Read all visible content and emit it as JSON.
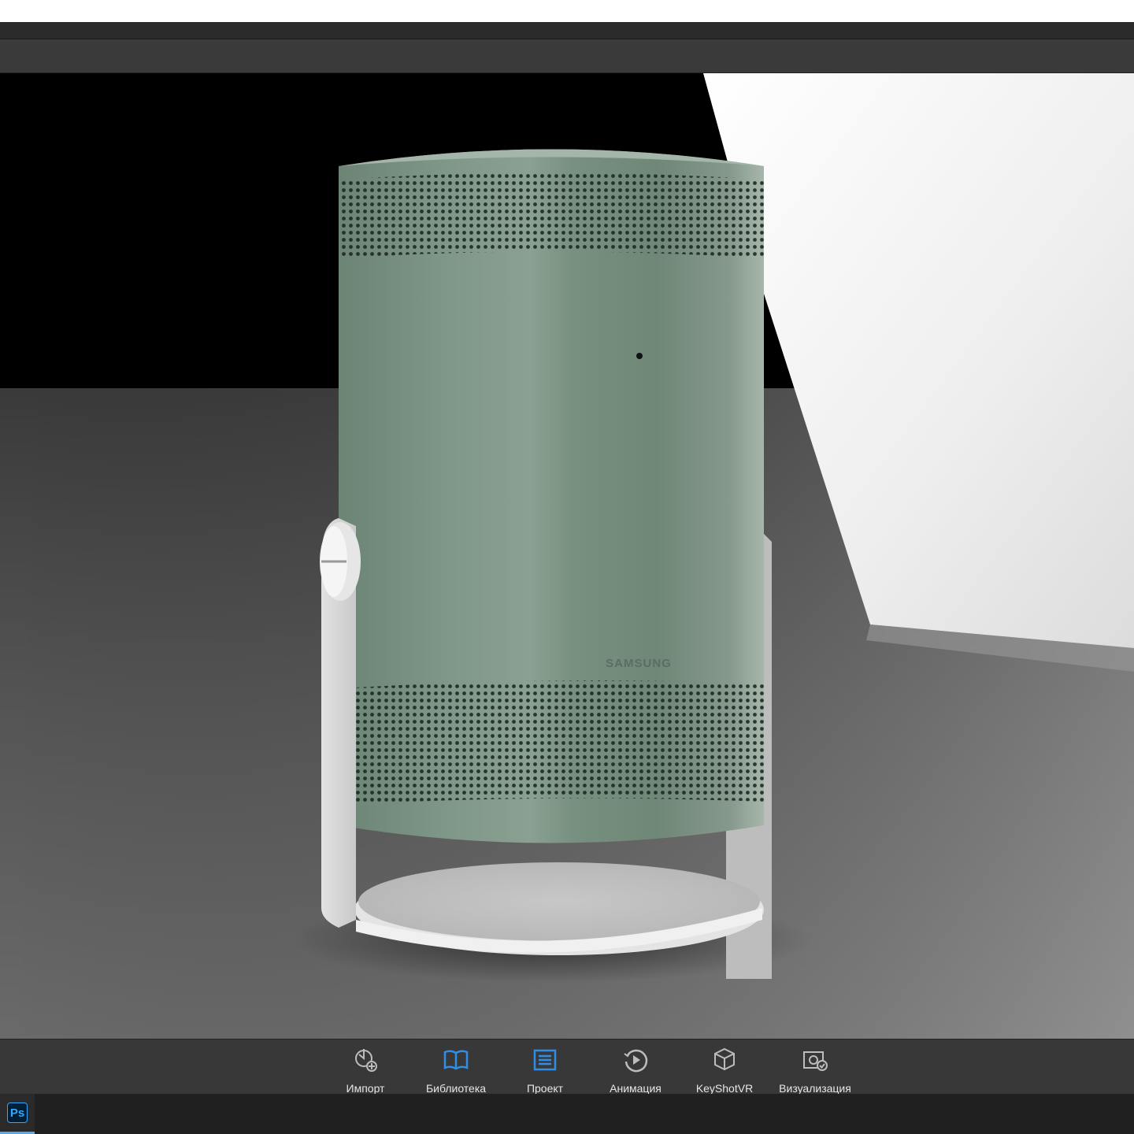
{
  "app": {
    "brand_mark": "SAMSUNG"
  },
  "ribbon": {
    "buttons": [
      {
        "key": "import",
        "label": "Импорт",
        "icon": "import-icon",
        "active": false
      },
      {
        "key": "library",
        "label": "Библиотека",
        "icon": "library-book-icon",
        "active": true
      },
      {
        "key": "project",
        "label": "Проект",
        "icon": "project-list-icon",
        "active": true
      },
      {
        "key": "animation",
        "label": "Анимация",
        "icon": "animation-play-icon",
        "active": false
      },
      {
        "key": "keyshotvr",
        "label": "KeyShotVR",
        "icon": "keyshotvr-cube-icon",
        "active": false
      },
      {
        "key": "render",
        "label": "Визуализация",
        "icon": "render-camera-icon",
        "active": false
      }
    ],
    "accent_color": "#2f8fe8",
    "inactive_icon_color": "#bdbdbd"
  },
  "taskbar": {
    "apps": [
      {
        "label": "Ps",
        "icon": "photoshop-icon",
        "active": true
      }
    ]
  },
  "scene": {
    "object_color": "#7d9584",
    "stand_color": "#d9d9d9"
  }
}
